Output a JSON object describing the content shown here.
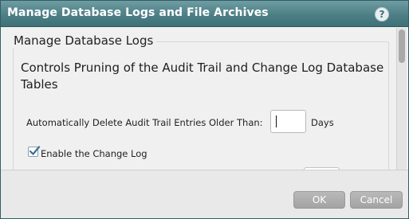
{
  "dialog": {
    "title": "Manage Database Logs and File Archives",
    "help_label": "?"
  },
  "section": {
    "legend": "Manage Database Logs",
    "description": "Controls Pruning of the Audit Trail and Change Log Database Tables"
  },
  "audit_trail": {
    "label": "Automatically Delete Audit Trail Entries Older Than:",
    "value": "",
    "unit": "Days"
  },
  "change_log": {
    "label": "Enable the Change Log",
    "checked": true
  },
  "footer": {
    "ok_label": "OK",
    "cancel_label": "Cancel"
  },
  "colors": {
    "titlebar": "#4d7f86",
    "button": "#a9a9a9"
  }
}
